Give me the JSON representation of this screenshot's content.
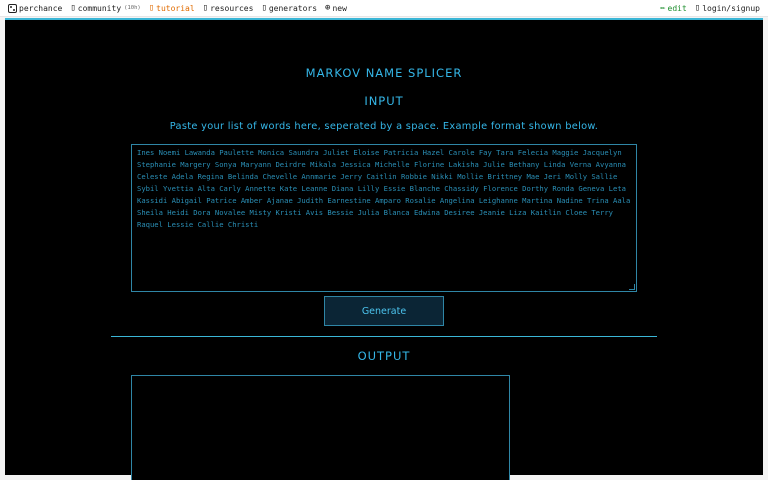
{
  "nav": {
    "brand": "perchance",
    "community": "community",
    "community_count": "(10h)",
    "tutorial": "tutorial",
    "resources": "resources",
    "generators": "generators",
    "new": "new",
    "edit": "edit",
    "login": "login/signup",
    "icons": {
      "brand": "dice-icon",
      "community": "chat-icon",
      "tutorial": "book-icon",
      "resources": "book-icon",
      "generators": "book-icon",
      "new": "plus-circle-icon",
      "edit": "pencil-icon",
      "login": "user-icon"
    }
  },
  "main": {
    "title": "MARKOV NAME SPLICER",
    "input_heading": "INPUT",
    "instructions": "Paste your list of words here, seperated by a space. Example format shown below.",
    "input_text": "Ines Noemi Lawanda Paulette Monica Saundra Juliet Eloise Patricia Hazel Carole Fay Tara Felecia Maggie Jacquelyn Stephanie Margery Sonya Maryann Deirdre Mikala Jessica Michelle Florine Lakisha Julie Bethany Linda Verna Avyanna Celeste Adela Regina Belinda Chevelle Annmarie Jerry Caitlin Robbie Nikki Mollie Brittney Mae Jeri Molly Sallie Sybil Yvettia Alta Carly Annette Kate Leanne Diana Lilly Essie Blanche Chassidy Florence Dorthy Ronda Geneva Leta Kassidi Abigail Patrice Amber Ajanae Judith Earnestine Amparo Rosalie Angelina Leighanne Martina Nadine Trina Aala Sheila Heidi Dora Novalee Misty Kristi Avis Bessie Julia Blanca Edwina Desiree Jeanie Liza Kaitlin Cloee Terry Raquel Lessie Callie Christi",
    "generate_label": "Generate",
    "output_heading": "OUTPUT",
    "output_text": ""
  },
  "colors": {
    "accent": "#35b7e8",
    "background": "#000000",
    "tutorial": "#e06b00",
    "edit": "#1e8f2e"
  }
}
